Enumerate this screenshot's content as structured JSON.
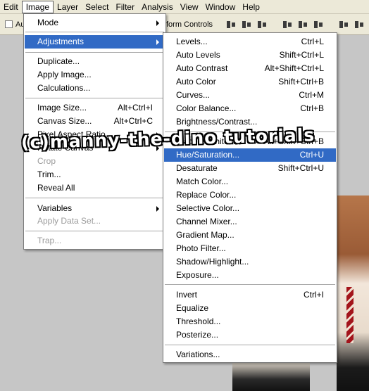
{
  "menubar": {
    "items": [
      "Edit",
      "Image",
      "Layer",
      "Select",
      "Filter",
      "Analysis",
      "View",
      "Window",
      "Help"
    ],
    "active": "Image"
  },
  "optionsbar": {
    "auto_label": "Au",
    "transform_label": "form Controls"
  },
  "image_menu": {
    "mode": "Mode",
    "adjustments": "Adjustments",
    "duplicate": "Duplicate...",
    "apply_image": "Apply Image...",
    "calculations": "Calculations...",
    "image_size": "Image Size...",
    "image_size_sc": "Alt+Ctrl+I",
    "canvas_size": "Canvas Size...",
    "canvas_size_sc": "Alt+Ctrl+C",
    "pixel_aspect": "Pixel Aspect Ratio",
    "rotate_canvas": "Rotate Canvas",
    "crop": "Crop",
    "trim": "Trim...",
    "reveal_all": "Reveal All",
    "variables": "Variables",
    "apply_data_set": "Apply Data Set...",
    "trap": "Trap..."
  },
  "adjust_menu": {
    "levels": "Levels...",
    "levels_sc": "Ctrl+L",
    "auto_levels": "Auto Levels",
    "auto_levels_sc": "Shift+Ctrl+L",
    "auto_contrast": "Auto Contrast",
    "auto_contrast_sc": "Alt+Shift+Ctrl+L",
    "auto_color": "Auto Color",
    "auto_color_sc": "Shift+Ctrl+B",
    "curves": "Curves...",
    "curves_sc": "Ctrl+M",
    "color_balance": "Color Balance...",
    "color_balance_sc": "Ctrl+B",
    "brightness_contrast": "Brightness/Contrast...",
    "black_white": "Black & White...",
    "black_white_sc": "Alt+Shift+Ctrl+B",
    "hue_saturation": "Hue/Saturation...",
    "hue_saturation_sc": "Ctrl+U",
    "desaturate": "Desaturate",
    "desaturate_sc": "Shift+Ctrl+U",
    "match_color": "Match Color...",
    "replace_color": "Replace Color...",
    "selective_color": "Selective Color...",
    "channel_mixer": "Channel Mixer...",
    "gradient_map": "Gradient Map...",
    "photo_filter": "Photo Filter...",
    "shadow_highlight": "Shadow/Highlight...",
    "exposure": "Exposure...",
    "invert": "Invert",
    "invert_sc": "Ctrl+I",
    "equalize": "Equalize",
    "threshold": "Threshold...",
    "posterize": "Posterize...",
    "variations": "Variations..."
  },
  "watermark": "(c)manny-the-dino tutorials",
  "colors": {
    "highlight": "#316ac5",
    "menubar": "#ece9d8",
    "background": "#c6c6c6"
  }
}
